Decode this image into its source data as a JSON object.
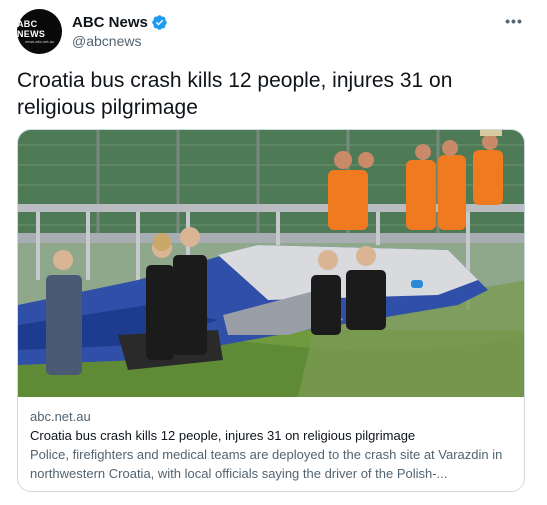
{
  "tweet": {
    "avatar_label": "ABC NEWS",
    "avatar_sub": "news.abc.net.au",
    "display_name": "ABC News",
    "handle": "@abcnews",
    "more_label": "•••",
    "text": "Croatia bus crash kills 12 people, injures 31 on religious pilgrimage"
  },
  "card": {
    "domain": "abc.net.au",
    "title": "Croatia bus crash kills 12 people, injures 31 on religious pilgrimage",
    "description": "Police, firefighters and medical teams are deployed to the crash site at Varazdin in northwestern Croatia, with local officials saying the driver of the Polish-..."
  },
  "colors": {
    "verified": "#1d9bf0",
    "muted": "#536471",
    "border": "#cfd9de"
  },
  "icons": {
    "verified": "verified-badge-icon",
    "more": "more-dots-icon"
  }
}
